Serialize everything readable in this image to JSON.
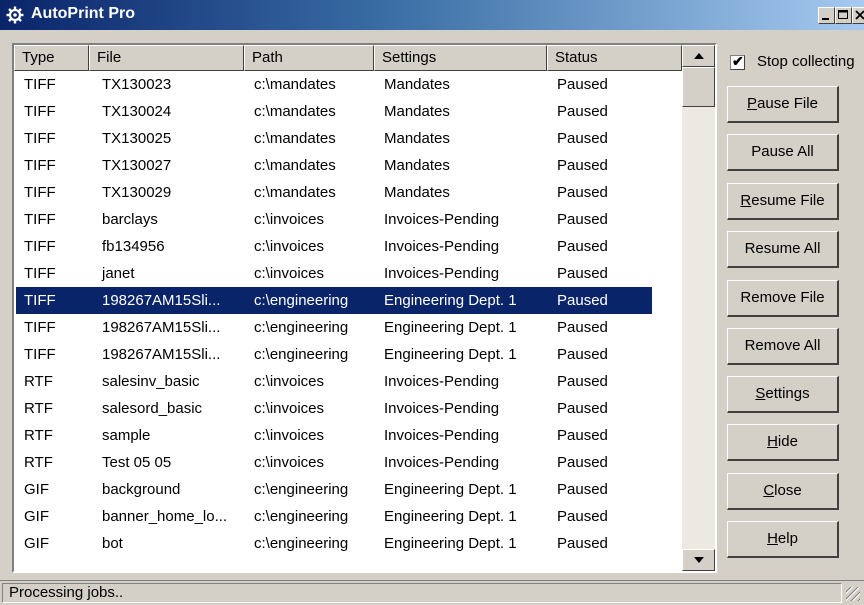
{
  "window": {
    "title": "AutoPrint Pro",
    "icon": "gear-icon",
    "controls": [
      "minimize-icon",
      "maximize-icon",
      "close-icon"
    ]
  },
  "table": {
    "columns": [
      {
        "key": "type",
        "label": "Type"
      },
      {
        "key": "file",
        "label": "File"
      },
      {
        "key": "path",
        "label": "Path"
      },
      {
        "key": "settings",
        "label": "Settings"
      },
      {
        "key": "status",
        "label": "Status"
      }
    ],
    "selected_index": 8,
    "rows": [
      {
        "type": "TIFF",
        "file": "TX130023",
        "path": "c:\\mandates",
        "settings": "Mandates",
        "status": "Paused"
      },
      {
        "type": "TIFF",
        "file": "TX130024",
        "path": "c:\\mandates",
        "settings": "Mandates",
        "status": "Paused"
      },
      {
        "type": "TIFF",
        "file": "TX130025",
        "path": "c:\\mandates",
        "settings": "Mandates",
        "status": "Paused"
      },
      {
        "type": "TIFF",
        "file": "TX130027",
        "path": "c:\\mandates",
        "settings": "Mandates",
        "status": "Paused"
      },
      {
        "type": "TIFF",
        "file": "TX130029",
        "path": "c:\\mandates",
        "settings": "Mandates",
        "status": "Paused"
      },
      {
        "type": "TIFF",
        "file": "barclays",
        "path": "c:\\invoices",
        "settings": "Invoices-Pending",
        "status": "Paused"
      },
      {
        "type": "TIFF",
        "file": "fb134956",
        "path": "c:\\invoices",
        "settings": "Invoices-Pending",
        "status": "Paused"
      },
      {
        "type": "TIFF",
        "file": "janet",
        "path": "c:\\invoices",
        "settings": "Invoices-Pending",
        "status": "Paused"
      },
      {
        "type": "TIFF",
        "file": "198267AM15Sli...",
        "path": "c:\\engineering",
        "settings": "Engineering Dept. 1",
        "status": "Paused"
      },
      {
        "type": "TIFF",
        "file": "198267AM15Sli...",
        "path": "c:\\engineering",
        "settings": "Engineering Dept. 1",
        "status": "Paused"
      },
      {
        "type": "TIFF",
        "file": "198267AM15Sli...",
        "path": "c:\\engineering",
        "settings": "Engineering Dept. 1",
        "status": "Paused"
      },
      {
        "type": "RTF",
        "file": "salesinv_basic",
        "path": "c:\\invoices",
        "settings": "Invoices-Pending",
        "status": "Paused"
      },
      {
        "type": "RTF",
        "file": "salesord_basic",
        "path": "c:\\invoices",
        "settings": "Invoices-Pending",
        "status": "Paused"
      },
      {
        "type": "RTF",
        "file": "sample",
        "path": "c:\\invoices",
        "settings": "Invoices-Pending",
        "status": "Paused"
      },
      {
        "type": "RTF",
        "file": "Test 05 05",
        "path": "c:\\invoices",
        "settings": "Invoices-Pending",
        "status": "Paused"
      },
      {
        "type": "GIF",
        "file": "background",
        "path": "c:\\engineering",
        "settings": "Engineering Dept. 1",
        "status": "Paused"
      },
      {
        "type": "GIF",
        "file": "banner_home_lo...",
        "path": "c:\\engineering",
        "settings": "Engineering Dept. 1",
        "status": "Paused"
      },
      {
        "type": "GIF",
        "file": "bot",
        "path": "c:\\engineering",
        "settings": "Engineering Dept. 1",
        "status": "Paused"
      }
    ]
  },
  "checkbox": {
    "label": "Stop collecting",
    "checked": true,
    "mark": "✔"
  },
  "buttons": [
    {
      "id": "pause-file-button",
      "label": "Pause File",
      "accel": "P"
    },
    {
      "id": "pause-all-button",
      "label": "Pause All",
      "accel": ""
    },
    {
      "id": "resume-file-button",
      "label": "Resume File",
      "accel": "R"
    },
    {
      "id": "resume-all-button",
      "label": "Resume All",
      "accel": ""
    },
    {
      "id": "remove-file-button",
      "label": "Remove File",
      "accel": ""
    },
    {
      "id": "remove-all-button",
      "label": "Remove All",
      "accel": ""
    },
    {
      "id": "settings-button",
      "label": "Settings",
      "accel": "S"
    },
    {
      "id": "hide-button",
      "label": "Hide",
      "accel": "H"
    },
    {
      "id": "close-button",
      "label": "Close",
      "accel": "C"
    },
    {
      "id": "help-button",
      "label": "Help",
      "accel": "H"
    }
  ],
  "statusbar": {
    "text": "Processing jobs.."
  },
  "colors": {
    "selection": "#0a246a",
    "face": "#d4d0c8",
    "title_start": "#0a246a",
    "title_end": "#a6caf0"
  }
}
